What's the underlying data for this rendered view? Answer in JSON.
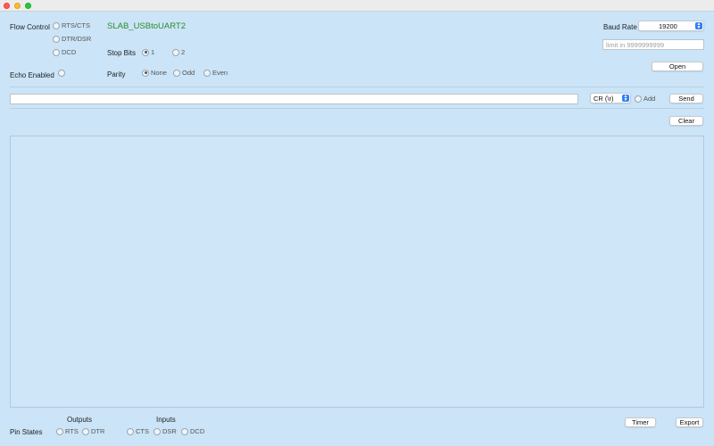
{
  "window": {
    "traffic_lights": {
      "close": "#ff5f57",
      "minimize": "#febc2e",
      "zoom": "#28c840"
    }
  },
  "flow_control": {
    "label": "Flow Control",
    "options": [
      "RTS/CTS",
      "DTR/DSR",
      "DCD"
    ]
  },
  "device_name": "SLAB_USBtoUART2",
  "stop_bits": {
    "label": "Stop Bits",
    "options": [
      "1",
      "2"
    ],
    "selected": "1"
  },
  "echo": {
    "label": "Echo Enabled"
  },
  "parity": {
    "label": "Parity",
    "options": [
      "None",
      "Odd",
      "Even"
    ],
    "selected": "None"
  },
  "baud_rate": {
    "label": "Baud Rate",
    "value": "19200"
  },
  "limit_field": {
    "placeholder": "limit in 9999999999"
  },
  "open_button": "Open",
  "send_bar": {
    "input_value": "",
    "line_ending": "CR (\\r)",
    "add_label": "Add",
    "send_label": "Send"
  },
  "clear_button": "Clear",
  "pins": {
    "label": "Pin States",
    "outputs_label": "Outputs",
    "inputs_label": "Inputs",
    "outputs": [
      "RTS",
      "DTR"
    ],
    "inputs": [
      "CTS",
      "DSR",
      "DCD"
    ]
  },
  "timer_button": "Timer",
  "export_button": "Export",
  "colors": {
    "background": "#cbe4f7",
    "device_name": "#2e8b2e",
    "accent": "#2f7ff5"
  }
}
